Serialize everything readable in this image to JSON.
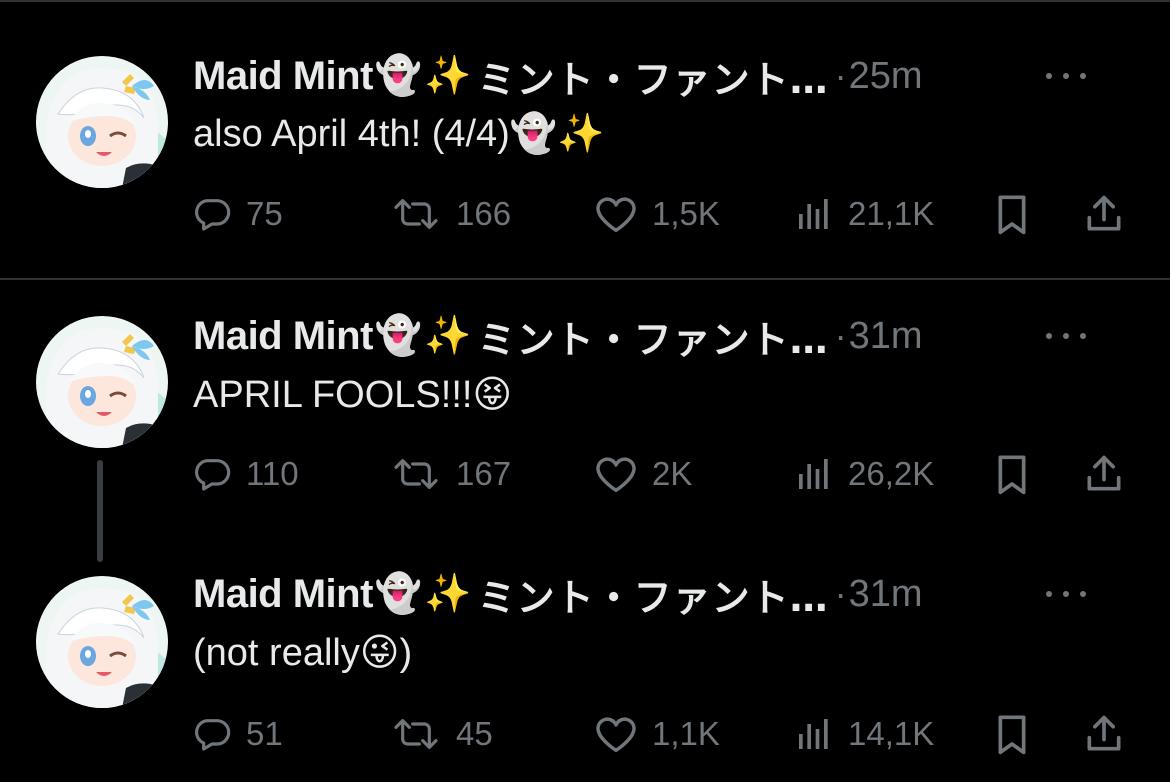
{
  "tweets": [
    {
      "display_name": "Maid Mint",
      "name_emoji_1": "👻",
      "name_emoji_2": "✨",
      "name_jp": "ミント・ファント…",
      "separator": "·",
      "time": "25m",
      "text": "also April 4th! (4/4)👻✨",
      "replies": "75",
      "retweets": "166",
      "likes": "1,5K",
      "views": "21,1K"
    },
    {
      "display_name": "Maid Mint",
      "name_emoji_1": "👻",
      "name_emoji_2": "✨",
      "name_jp": "ミント・ファント…",
      "separator": "·",
      "time": "31m",
      "text": "APRIL FOOLS!!!😝",
      "replies": "110",
      "retweets": "167",
      "likes": "2K",
      "views": "26,2K"
    },
    {
      "display_name": "Maid Mint",
      "name_emoji_1": "👻",
      "name_emoji_2": "✨",
      "name_jp": "ミント・ファント…",
      "separator": "·",
      "time": "31m",
      "text": "(not really😜)",
      "replies": "51",
      "retweets": "45",
      "likes": "1,1K",
      "views": "14,1K"
    }
  ],
  "icons": {
    "reply": "reply-icon",
    "retweet": "retweet-icon",
    "like": "heart-icon",
    "views": "views-icon",
    "bookmark": "bookmark-icon",
    "share": "share-icon",
    "more": "more-icon"
  },
  "colors": {
    "background": "#000000",
    "primary_text": "#e7e9ea",
    "secondary_text": "#71767b",
    "divider": "#2f3336"
  }
}
